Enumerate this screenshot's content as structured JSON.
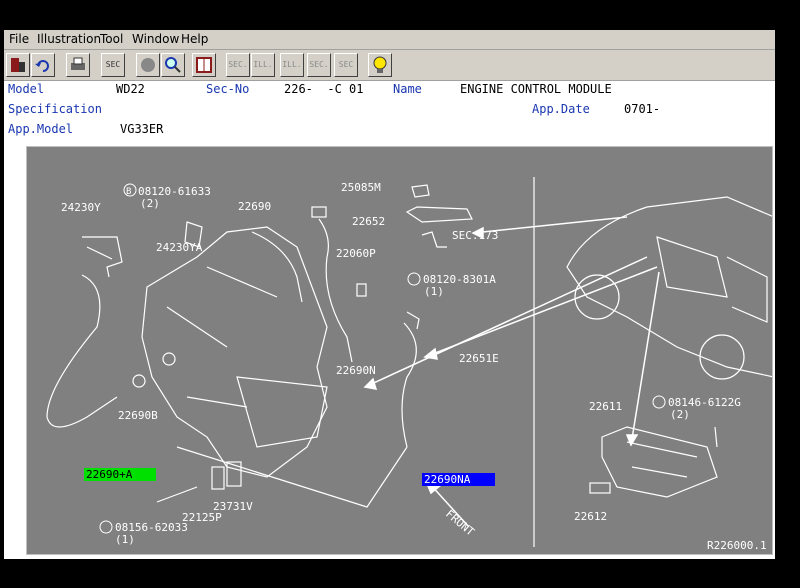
{
  "menu": {
    "file": "File",
    "illustration": "Illustration",
    "tool": "Tool",
    "window": "Window",
    "help": "Help"
  },
  "toolbar": {
    "sec_label": "SEC",
    "btn_sec_prev": "SEC.",
    "btn_ill_first": "ILL.",
    "btn_ill_next": "ILL.",
    "btn_sec_next": "SEC.",
    "btn_sec_query": "SEC"
  },
  "info": {
    "model_label": "Model",
    "model_value": "WD22",
    "secno_label": "Sec-No",
    "secno_value": "226-  -C 01",
    "name_label": "Name",
    "name_value": "ENGINE CONTROL MODULE",
    "spec_label": "Specification",
    "appdate_label": "App.Date",
    "appdate_value": "0701-",
    "appmodel_label": "App.Model",
    "appmodel_value": "VG33ER"
  },
  "parts": {
    "p24230Y": "24230Y",
    "p08120_61633": "08120-61633",
    "p08120_61633_qty": "(2)",
    "p24230YA": "24230YA",
    "p22690": "22690",
    "p25085M": "25085M",
    "p22652": "22652",
    "sec173": "SEC.173",
    "p22060P": "22060P",
    "p08120_8301A": "08120-8301A",
    "p08120_8301A_qty": "(1)",
    "p22690N": "22690N",
    "p22651E": "22651E",
    "p22690B": "22690B",
    "p22690A": "22690+A",
    "p22690NA": "22690NA",
    "p22125P": "22125P",
    "p23731V": "23731V",
    "p08156_62033": "08156-62033",
    "p08156_62033_qty": "(1)",
    "p22611": "22611",
    "p08146_6122G": "08146-6122G",
    "p08146_6122G_qty": "(2)",
    "p22612": "22612",
    "front": "FRONT",
    "drawing_code": "R226000.1",
    "bolt_symbol": "B"
  },
  "colors": {
    "highlight_green": "#00e000",
    "highlight_blue": "#0000ff",
    "label_blue": "#1a37b0",
    "drawing_bg": "#808080"
  }
}
